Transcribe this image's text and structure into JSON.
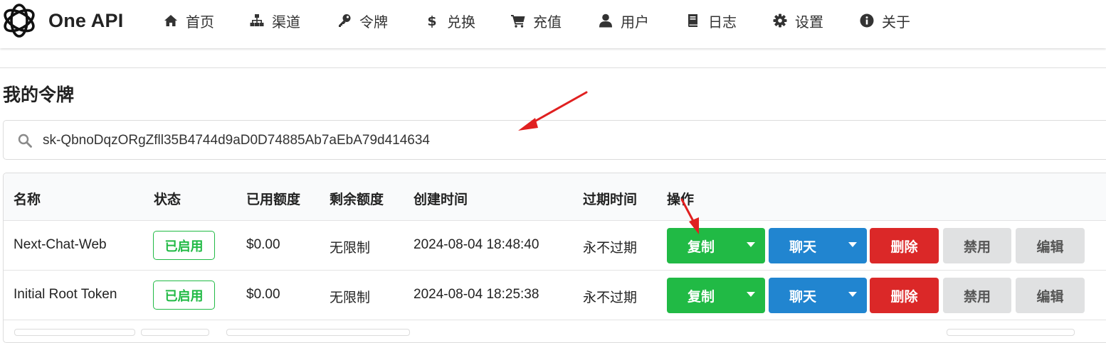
{
  "app": {
    "brand_name": "One API",
    "logo_icon": "openai-logo-icon"
  },
  "nav": {
    "items": [
      {
        "label": "首页",
        "icon": "home-icon"
      },
      {
        "label": "渠道",
        "icon": "sitemap-icon"
      },
      {
        "label": "令牌",
        "icon": "key-icon"
      },
      {
        "label": "兑换",
        "icon": "dollar-icon"
      },
      {
        "label": "充值",
        "icon": "cart-icon"
      },
      {
        "label": "用户",
        "icon": "user-icon"
      },
      {
        "label": "日志",
        "icon": "book-icon"
      },
      {
        "label": "设置",
        "icon": "gear-icon"
      },
      {
        "label": "关于",
        "icon": "info-icon"
      }
    ]
  },
  "page": {
    "title": "我的令牌"
  },
  "search": {
    "value": "sk-QbnoDqzORgZfll35B4744d9aD0D74885Ab7aEbA79d414634"
  },
  "table": {
    "columns": [
      "名称",
      "状态",
      "已用额度",
      "剩余额度",
      "创建时间",
      "过期时间",
      "操作"
    ],
    "rows": [
      {
        "name": "Next-Chat-Web",
        "status": "已启用",
        "used": "$0.00",
        "remaining": "无限制",
        "created": "2024-08-04 18:48:40",
        "expires": "永不过期"
      },
      {
        "name": "Initial Root Token",
        "status": "已启用",
        "used": "$0.00",
        "remaining": "无限制",
        "created": "2024-08-04 18:25:38",
        "expires": "永不过期"
      }
    ],
    "actions": {
      "copy": "复制",
      "chat": "聊天",
      "delete": "删除",
      "disable": "禁用",
      "edit": "编辑"
    }
  },
  "colors": {
    "green": "#21ba45",
    "blue": "#2185d0",
    "red": "#db2828",
    "grey": "#e0e1e2",
    "annotation_red": "#e02020"
  }
}
